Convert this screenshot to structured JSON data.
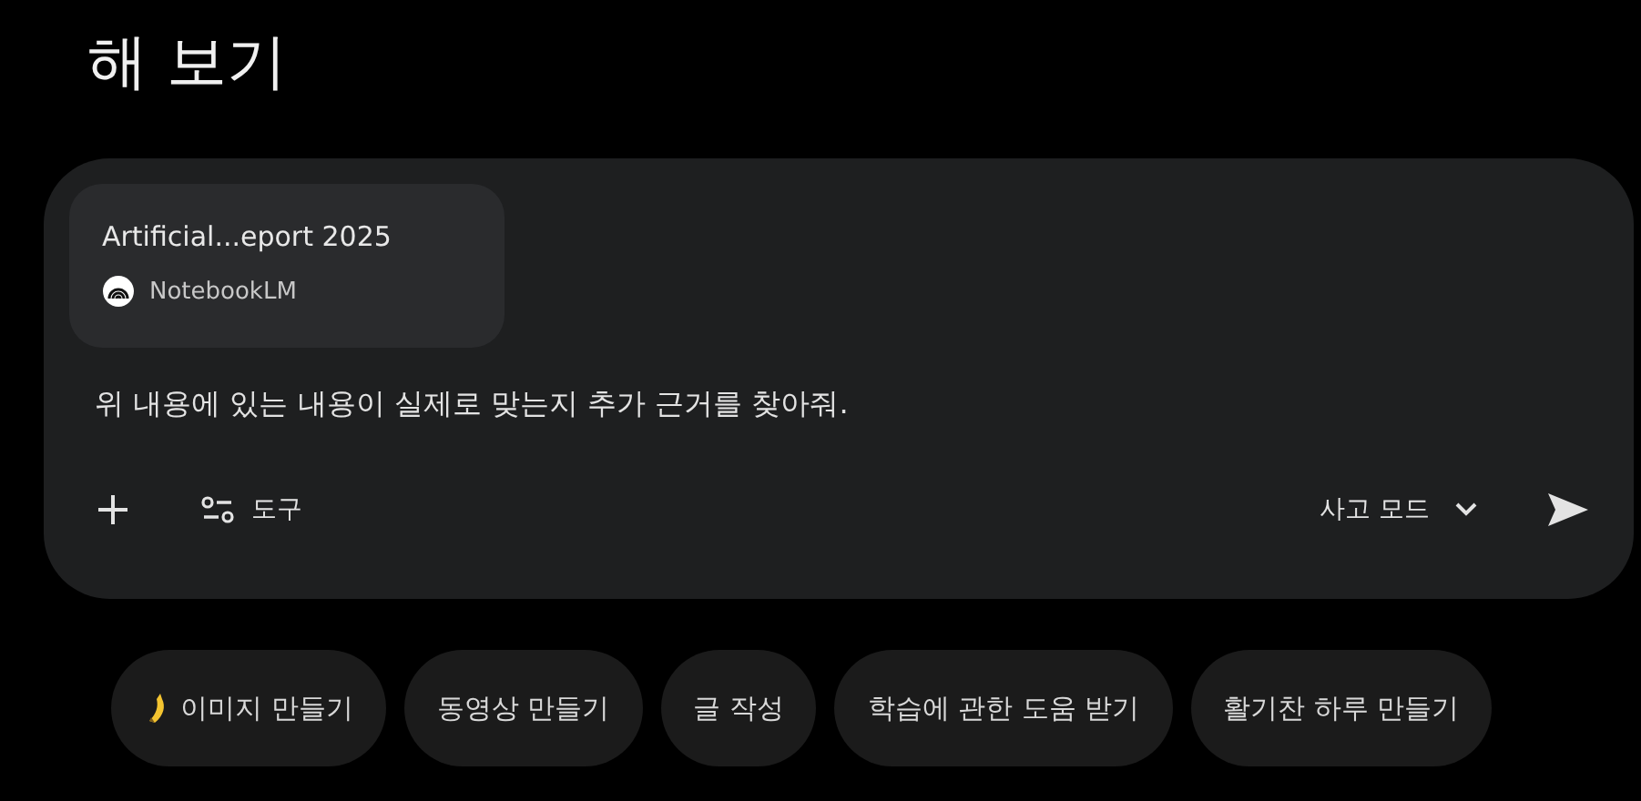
{
  "heading": "해 보기",
  "attachment": {
    "title": "Artificial...eport 2025",
    "source": "NotebookLM"
  },
  "prompt": {
    "value": "위 내용에 있는 내용이 실제로 맞는지 추가 근거를 찾아줘."
  },
  "toolbar": {
    "tools_label": "도구",
    "mode_label": "사고 모드"
  },
  "suggestions": [
    {
      "label": "이미지 만들기",
      "kind": "banana"
    },
    {
      "label": "동영상 만들기",
      "kind": "plain"
    },
    {
      "label": "글 작성",
      "kind": "plain"
    },
    {
      "label": "학습에 관한 도움 받기",
      "kind": "plain"
    },
    {
      "label": "활기찬 하루 만들기",
      "kind": "plain"
    }
  ]
}
